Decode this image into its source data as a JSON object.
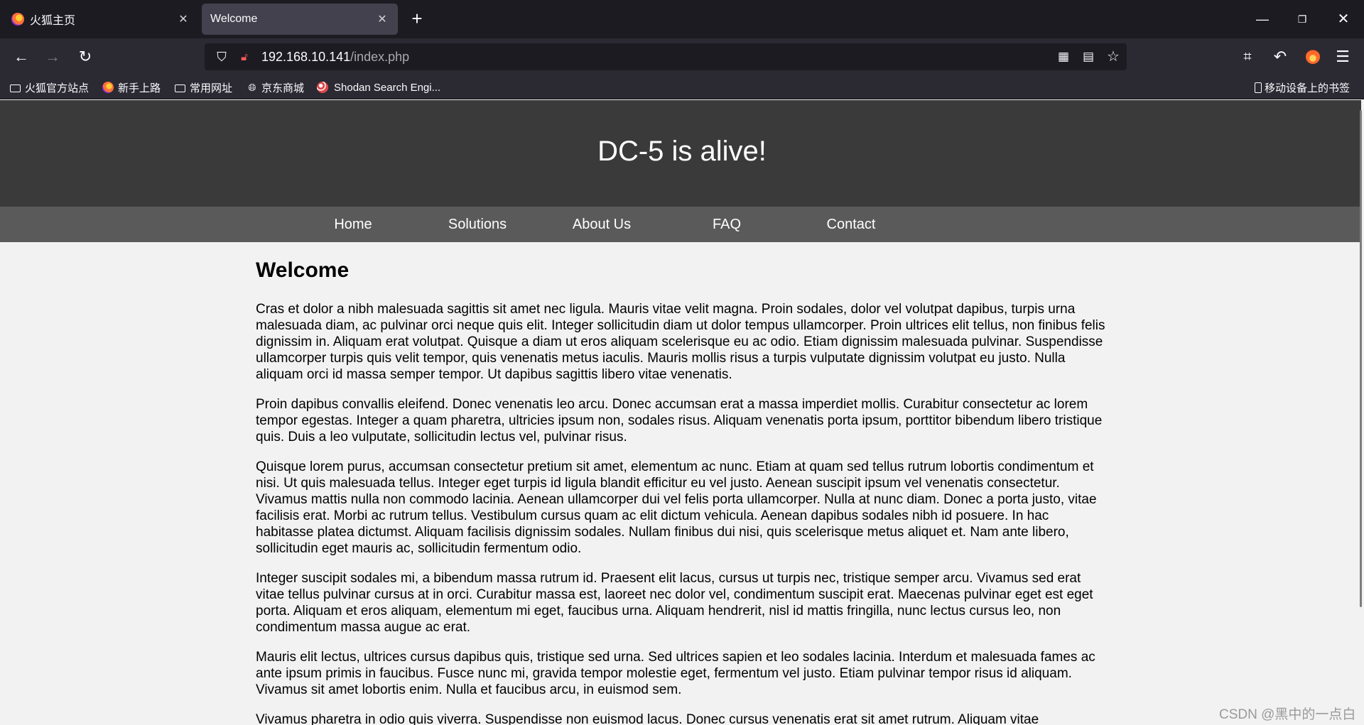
{
  "browser": {
    "tabs": [
      {
        "title": "火狐主页",
        "active": false
      },
      {
        "title": "Welcome",
        "active": true
      }
    ],
    "new_tab_label": "+",
    "url": {
      "host": "192.168.10.141",
      "path": "/index.php"
    },
    "bookmarks": [
      {
        "label": "火狐官方站点",
        "icon": "folder-icon"
      },
      {
        "label": "新手上路",
        "icon": "firefox-icon"
      },
      {
        "label": "常用网址",
        "icon": "folder-icon"
      },
      {
        "label": "京东商城",
        "icon": "globe-icon"
      },
      {
        "label": "Shodan Search Engi...",
        "icon": "shodan-icon"
      }
    ],
    "mobile_bookmarks_label": "移动设备上的书签"
  },
  "site": {
    "title": "DC-5 is alive!",
    "nav": [
      "Home",
      "Solutions",
      "About Us",
      "FAQ",
      "Contact"
    ],
    "heading": "Welcome",
    "paragraphs": [
      "Cras et dolor a nibh malesuada sagittis sit amet nec ligula. Mauris vitae velit magna. Proin sodales, dolor vel volutpat dapibus, turpis urna malesuada diam, ac pulvinar orci neque quis elit. Integer sollicitudin diam ut dolor tempus ullamcorper. Proin ultrices elit tellus, non finibus felis dignissim in. Aliquam erat volutpat. Quisque a diam ut eros aliquam scelerisque eu ac odio. Etiam dignissim malesuada pulvinar. Suspendisse ullamcorper turpis quis velit tempor, quis venenatis metus iaculis. Mauris mollis risus a turpis vulputate dignissim volutpat eu justo. Nulla aliquam orci id massa semper tempor. Ut dapibus sagittis libero vitae venenatis.",
      "Proin dapibus convallis eleifend. Donec venenatis leo arcu. Donec accumsan erat a massa imperdiet mollis. Curabitur consectetur ac lorem tempor egestas. Integer a quam pharetra, ultricies ipsum non, sodales risus. Aliquam venenatis porta ipsum, porttitor bibendum libero tristique quis. Duis a leo vulputate, sollicitudin lectus vel, pulvinar risus.",
      "Quisque lorem purus, accumsan consectetur pretium sit amet, elementum ac nunc. Etiam at quam sed tellus rutrum lobortis condimentum et nisi. Ut quis malesuada tellus. Integer eget turpis id ligula blandit efficitur eu vel justo. Aenean suscipit ipsum vel venenatis consectetur. Vivamus mattis nulla non commodo lacinia. Aenean ullamcorper dui vel felis porta ullamcorper. Nulla at nunc diam. Donec a porta justo, vitae facilisis erat. Morbi ac rutrum tellus. Vestibulum cursus quam ac elit dictum vehicula. Aenean dapibus sodales nibh id posuere. In hac habitasse platea dictumst. Aliquam facilisis dignissim sodales. Nullam finibus dui nisi, quis scelerisque metus aliquet et. Nam ante libero, sollicitudin eget mauris ac, sollicitudin fermentum odio.",
      "Integer suscipit sodales mi, a bibendum massa rutrum id. Praesent elit lacus, cursus ut turpis nec, tristique semper arcu. Vivamus sed erat vitae tellus pulvinar cursus at in orci. Curabitur massa est, laoreet nec dolor vel, condimentum suscipit erat. Maecenas pulvinar eget est eget porta. Aliquam et eros aliquam, elementum mi eget, faucibus urna. Aliquam hendrerit, nisl id mattis fringilla, nunc lectus cursus leo, non condimentum massa augue ac erat.",
      "Mauris elit lectus, ultrices cursus dapibus quis, tristique sed urna. Sed ultrices sapien et leo sodales lacinia. Interdum et malesuada fames ac ante ipsum primis in faucibus. Fusce nunc mi, gravida tempor molestie eget, fermentum vel justo. Etiam pulvinar tempor risus id aliquam. Vivamus sit amet lobortis enim. Nulla et faucibus arcu, in euismod sem.",
      "Vivamus pharetra in odio quis viverra. Suspendisse non euismod lacus. Donec cursus venenatis erat sit amet rutrum. Aliquam vitae"
    ]
  },
  "watermark": "CSDN @黑中的一点白",
  "colors": {
    "tabbar_bg": "#1c1b22",
    "toolbar_bg": "#2b2a33",
    "active_tab_bg": "#42414d",
    "site_header_bg": "#3a3a3a",
    "site_nav_bg": "#5a5a5a",
    "page_bg": "#f2f2f2"
  }
}
